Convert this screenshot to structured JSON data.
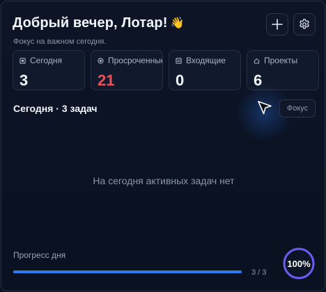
{
  "header": {
    "greeting": "Добрый вечер, Лотар!",
    "wave_emoji": "👋",
    "subtitle": "Фокус на важном сегодня.",
    "add_icon": "plus-icon",
    "settings_icon": "gear-icon"
  },
  "stats": [
    {
      "icon": "square-icon",
      "label": "Сегодня",
      "value": "3",
      "color": "#f2f5fa"
    },
    {
      "icon": "target-icon",
      "label": "Просроченные",
      "value": "21",
      "color": "#f0505a"
    },
    {
      "icon": "inbox-icon",
      "label": "Входящие",
      "value": "0",
      "color": "#f2f5fa"
    },
    {
      "icon": "house-icon",
      "label": "Проекты",
      "value": "6",
      "color": "#f2f5fa"
    }
  ],
  "today": {
    "title": "Сегодня · 3 задач",
    "focus_label": "Фокус",
    "empty_text": "На сегодня активных задач нет"
  },
  "progress": {
    "label": "Прогресс дня",
    "count": "3 / 3",
    "fraction": 1.0,
    "percent_label": "100%",
    "bar_color": "#2f7cf0",
    "ring_color": "#6a5cf0"
  }
}
